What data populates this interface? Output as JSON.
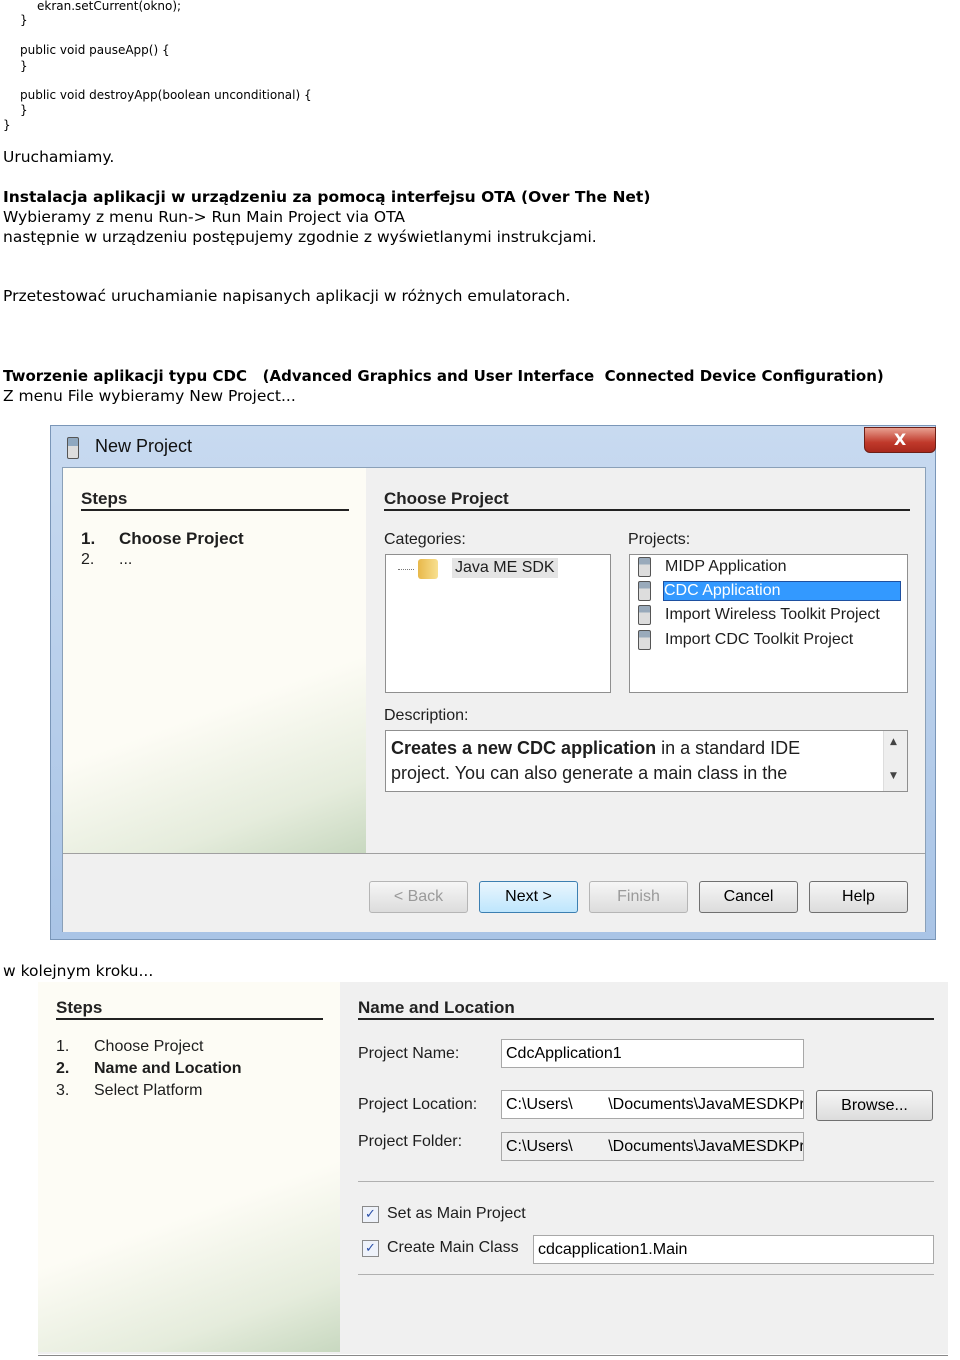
{
  "code_lines": [
    "ekran.setCurrent(okno);",
    "}",
    "public void pauseApp() {",
    "}",
    "public void destroyApp(boolean unconditional) {",
    "}",
    "}"
  ],
  "paragraphs": {
    "run": "Uruchamiamy.",
    "ota_heading": "Instalacja aplikacji w urządzeniu za pomocą interfejsu OTA (Over The Net)",
    "ota_line1": "Wybieramy z menu Run-> Run Main Project via OTA",
    "ota_line2": "następnie w urządzeniu postępujemy zgodnie z wyświetlanymi instrukcjami.",
    "test": "Przetestować uruchamianie napisanych aplikacji w różnych emulatorach.",
    "cdc_heading": "Tworzenie aplikacji typu CDC   (Advanced Graphics and User Interface  Connected Device Configuration)",
    "cdc_line": "Z menu File wybieramy New Project...",
    "next_step": "w kolejnym kroku..."
  },
  "dialog1": {
    "title": "New Project",
    "close_label": "X",
    "steps_heading": "Steps",
    "steps": [
      {
        "num": "1.",
        "label": "Choose Project"
      },
      {
        "num": "2.",
        "label": "..."
      }
    ],
    "panel_heading": "Choose Project",
    "categories_label": "Categories:",
    "categories": [
      "Java ME SDK"
    ],
    "projects_label": "Projects:",
    "projects": [
      "MIDP Application",
      "CDC Application",
      "Import Wireless Toolkit Project",
      "Import CDC Toolkit Project"
    ],
    "selected_project": "CDC Application",
    "description_label": "Description:",
    "description_bold": "Creates a new CDC application",
    "description_rest": " in a standard IDE",
    "description_line2": "project. You can also generate a main class in the",
    "buttons": {
      "back": "< Back",
      "next": "Next >",
      "finish": "Finish",
      "cancel": "Cancel",
      "help": "Help"
    }
  },
  "dialog2": {
    "steps_heading": "Steps",
    "steps": [
      {
        "num": "1.",
        "label": "Choose Project"
      },
      {
        "num": "2.",
        "label": "Name and Location"
      },
      {
        "num": "3.",
        "label": "Select Platform"
      }
    ],
    "panel_heading": "Name and Location",
    "project_name_label": "Project Name:",
    "project_name": "CdcApplication1",
    "project_location_label": "Project Location:",
    "project_location": "C:\\Users\\        \\Documents\\JavaMESDKProjects",
    "browse": "Browse...",
    "project_folder_label": "Project Folder:",
    "project_folder": "C:\\Users\\        \\Documents\\JavaMESDKProjects",
    "set_main_label": "Set as Main Project",
    "set_main_checked": true,
    "create_main_label": "Create Main Class",
    "create_main_checked": true,
    "main_class": "cdcapplication1.Main"
  }
}
